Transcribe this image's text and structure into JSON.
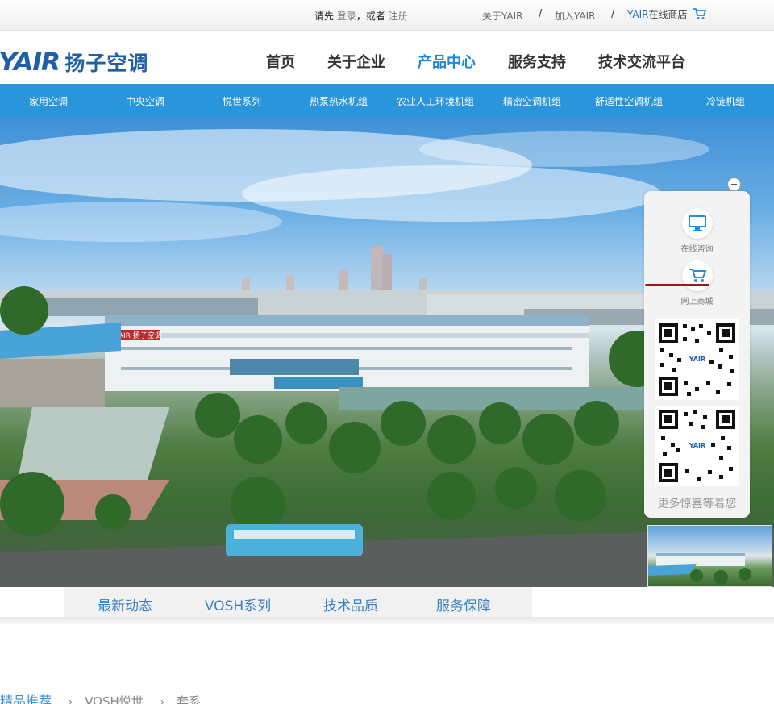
{
  "topbar": {
    "login_prefix": "请先",
    "login_link": "登录",
    "login_or": "，或者",
    "register_link": "注册",
    "about_link": "关于YAIR",
    "sep1": "/",
    "join_link": "加入YAIR",
    "sep2": "/",
    "shop_en": "YAIR",
    "shop_cn": "在线商店",
    "cart_icon": "cart-icon"
  },
  "logo": {
    "en": "YAIR",
    "cn": "扬子空调"
  },
  "mainnav": [
    "首页",
    "关于企业",
    "产品中心",
    "服务支持",
    "技术交流平台"
  ],
  "mainnav_active": "产品中心",
  "categories": [
    "家用空调",
    "中央空调",
    "悦世系列",
    "热泵热水机组",
    "农业人工环境机组",
    "精密空调机组",
    "舒适性空调机组",
    "冷链机组"
  ],
  "float_panel": {
    "consult_label": "在线咨询",
    "mall_label": "网上商城",
    "more_text": "更多惊喜等着您",
    "qr_logo": "YAIR"
  },
  "hero": {
    "building_sign": "YAIR 扬子空调"
  },
  "tabs": [
    "最新动态",
    "VOSH系列",
    "技术品质",
    "服务保障"
  ],
  "breadcrumb": {
    "first": "精品推荐",
    "second": "VOSH悦世",
    "third": "套系"
  },
  "colors": {
    "brand_blue": "#1e5fa8",
    "nav_active": "#1e88d8",
    "category_bar": "#2b95dc",
    "tab_text": "#3a7fc0",
    "accent_red": "#a3121b"
  }
}
